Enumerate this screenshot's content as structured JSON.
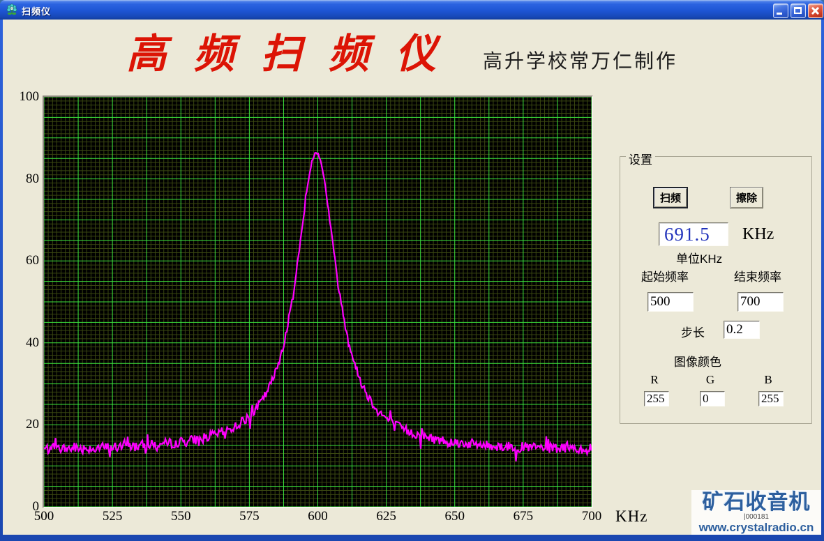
{
  "window": {
    "title": "扫频仪"
  },
  "header": {
    "title": "高 频 扫 频 仪",
    "title_color": "#dc1405",
    "subtitle": "高升学校常万仁制作"
  },
  "chart_data": {
    "type": "line",
    "title": "",
    "xlabel": "KHz",
    "ylabel": "",
    "xlim": [
      500,
      700
    ],
    "ylim": [
      0,
      100
    ],
    "x_ticks": [
      "500",
      "525",
      "550",
      "575",
      "600",
      "625",
      "650",
      "675",
      "700"
    ],
    "y_ticks": [
      "100",
      "80",
      "60",
      "40",
      "20",
      "0"
    ],
    "x_unit": "KHz",
    "grid": {
      "background": "#000000",
      "minor_color": "#3c4a12",
      "major_color": "#3de43d",
      "major_x_divisions": 16,
      "major_y_divisions": 20,
      "minor_per_major_x": 8,
      "minor_per_major_y": 5
    },
    "series": [
      {
        "name": "sweep-response",
        "color": "#ff00ff",
        "points": [
          [
            500,
            13.5
          ],
          [
            510,
            13.8
          ],
          [
            520,
            14.2
          ],
          [
            530,
            14.7
          ],
          [
            540,
            15.4
          ],
          [
            550,
            16.4
          ],
          [
            560,
            18.2
          ],
          [
            570,
            21.8
          ],
          [
            575,
            24.4
          ],
          [
            580,
            28.8
          ],
          [
            585,
            36.2
          ],
          [
            590,
            48.1
          ],
          [
            595,
            71.9
          ],
          [
            598,
            84.5
          ],
          [
            599.5,
            86.5
          ],
          [
            601,
            85.4
          ],
          [
            605,
            66.7
          ],
          [
            610,
            44.4
          ],
          [
            615,
            31.9
          ],
          [
            620,
            25.3
          ],
          [
            625,
            21.6
          ],
          [
            630,
            19.2
          ],
          [
            640,
            16.8
          ],
          [
            650,
            15.4
          ],
          [
            660,
            14.6
          ],
          [
            675,
            14.0
          ],
          [
            690,
            13.7
          ],
          [
            700,
            13.5
          ]
        ]
      }
    ],
    "model": {
      "kind": "lorentzian",
      "center": 599.5,
      "hwhm": 9,
      "amplitude": 73,
      "baseline": 13.5,
      "noise": 1.1,
      "seed": 7
    },
    "legend": null
  },
  "settings": {
    "legend": "设置",
    "sweep_button": "扫频",
    "erase_button": "擦除",
    "freq_display": {
      "value": "691.5",
      "unit": "KHz"
    },
    "unit_note": "单位KHz",
    "start_freq": {
      "label": "起始频率",
      "value": "500"
    },
    "end_freq": {
      "label": "结束频率",
      "value": "700"
    },
    "step": {
      "label": "步长",
      "value": "0.2"
    },
    "color_section": {
      "label": "图像颜色",
      "r": {
        "label": "R",
        "value": "255"
      },
      "g": {
        "label": "G",
        "value": "0"
      },
      "b": {
        "label": "B",
        "value": "255"
      }
    }
  },
  "watermark": {
    "brand": "矿石收音机",
    "serial": "|000181",
    "url": "www.crystalradio.cn"
  }
}
